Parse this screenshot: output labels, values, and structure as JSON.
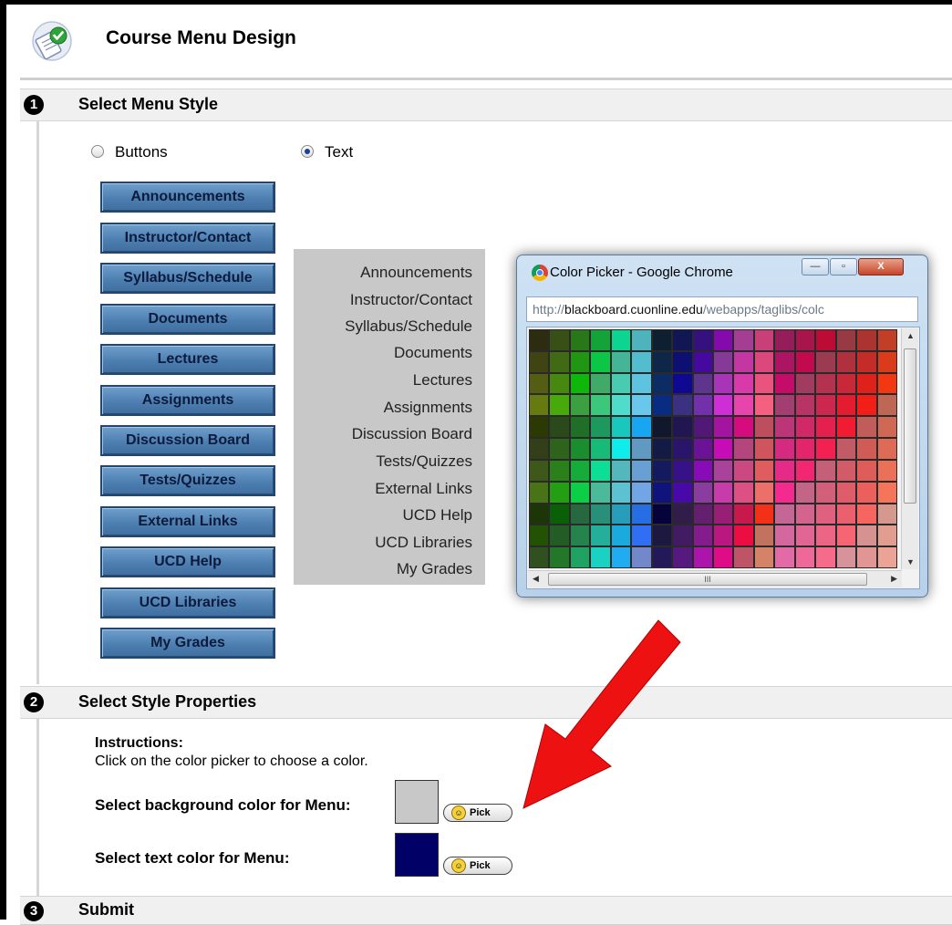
{
  "header": {
    "title": "Course Menu Design",
    "icon": "checklist-icon"
  },
  "section1": {
    "number": "1",
    "title": "Select Menu Style"
  },
  "style_options": [
    {
      "label": "Buttons",
      "selected": false
    },
    {
      "label": "Text",
      "selected": true
    }
  ],
  "menu_buttons": [
    "Announcements",
    "Instructor/Contact",
    "Syllabus/Schedule",
    "Documents",
    "Lectures",
    "Assignments",
    "Discussion Board",
    "Tests/Quizzes",
    "External Links",
    "UCD Help",
    "UCD Libraries",
    "My Grades"
  ],
  "text_menu": [
    "Announcements",
    "Instructor/Contact",
    "Syllabus/Schedule",
    "Documents",
    "Lectures",
    "Assignments",
    "Discussion Board",
    "Tests/Quizzes",
    "External Links",
    "UCD Help",
    "UCD Libraries",
    "My Grades"
  ],
  "picker_window": {
    "title": "Color Picker - Google Chrome",
    "url_prefix": "http://",
    "url_host": "blackboard.cuonline.edu",
    "url_path": "/webapps/taglibs/colc",
    "min_label": "—",
    "max_label": "▫",
    "close_label": "X",
    "hscroll_grip": "III"
  },
  "section2": {
    "number": "2",
    "title": "Select Style Properties",
    "instructions_title": "Instructions:",
    "instructions_text": "Click on the color picker to choose a color.",
    "bg_label": "Select background color for Menu:",
    "text_label": "Select text color for Menu:",
    "bg_color": "#c8c8c8",
    "text_color": "#000066",
    "pick_label": "Pick"
  },
  "section3": {
    "number": "3",
    "title": "Submit"
  },
  "colors": {
    "button_blue": "#4d7fb1",
    "arrow_red": "#ee1111"
  }
}
